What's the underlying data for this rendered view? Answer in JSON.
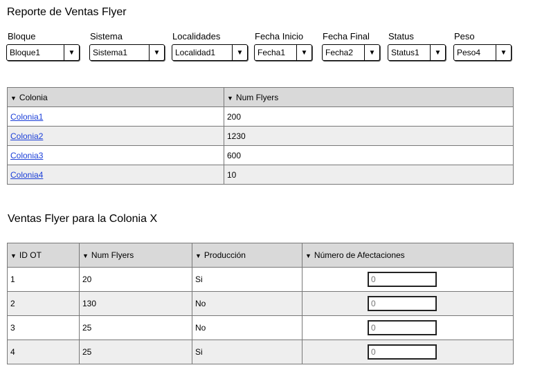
{
  "report_title": "Reporte de Ventas Flyer",
  "filters": [
    {
      "label": "Bloque",
      "value": "Bloque1"
    },
    {
      "label": "Sistema",
      "value": "Sistema1"
    },
    {
      "label": "Localidades",
      "value": "Localidad1"
    },
    {
      "label": "Fecha Inicio",
      "value": "Fecha1"
    },
    {
      "label": "Fecha Final",
      "value": "Fecha2"
    },
    {
      "label": "Status",
      "value": "Status1"
    },
    {
      "label": "Peso",
      "value": "Peso4"
    }
  ],
  "colonias_table": {
    "headers": [
      "Colonia",
      "Num Flyers"
    ],
    "rows": [
      {
        "colonia": "Colonia1",
        "num_flyers": "200"
      },
      {
        "colonia": "Colonia2",
        "num_flyers": "1230"
      },
      {
        "colonia": "Colonia3",
        "num_flyers": "600"
      },
      {
        "colonia": "Colonia4",
        "num_flyers": "10"
      }
    ]
  },
  "detail_title": "Ventas Flyer para la Colonia X",
  "detail_table": {
    "headers": [
      "ID OT",
      "Num Flyers",
      "Producción",
      "Número de Afectaciones"
    ],
    "rows": [
      {
        "id_ot": "1",
        "num_flyers": "20",
        "produccion": "Si",
        "afectaciones_placeholder": "0"
      },
      {
        "id_ot": "2",
        "num_flyers": "130",
        "produccion": "No",
        "afectaciones_placeholder": "0"
      },
      {
        "id_ot": "3",
        "num_flyers": "25",
        "produccion": "No",
        "afectaciones_placeholder": "0"
      },
      {
        "id_ot": "4",
        "num_flyers": "25",
        "produccion": "Si",
        "afectaciones_placeholder": "0"
      }
    ]
  },
  "icons": {
    "sort": "sort-down-icon",
    "dropdown": "chevron-down-icon"
  }
}
